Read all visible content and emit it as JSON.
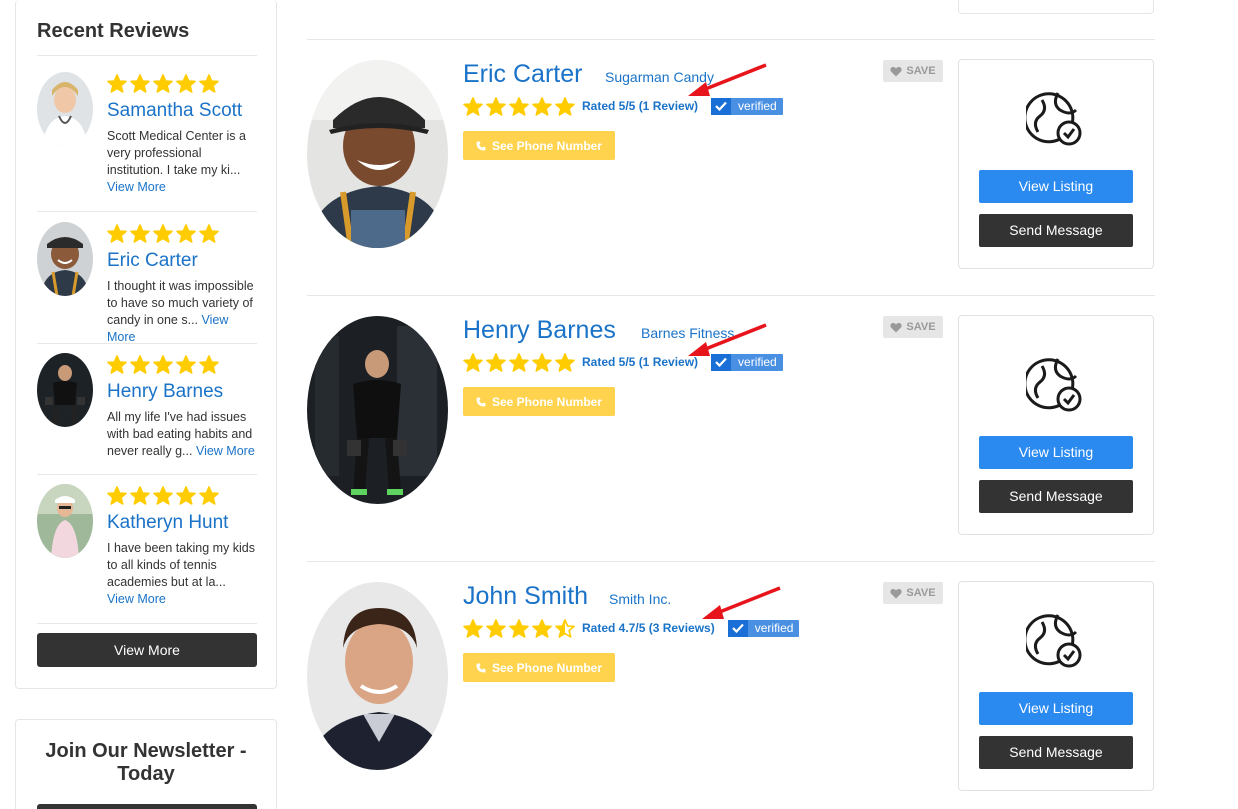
{
  "sidebar": {
    "title": "Recent Reviews",
    "reviews": [
      {
        "name": "Samantha Scott",
        "snippet": "Scott Medical Center is a very professional institution. I take my ki...",
        "more": "View More",
        "rating": 5
      },
      {
        "name": "Eric Carter",
        "snippet": "I thought it was impossible to have so much variety of candy in one s...",
        "more": "View More",
        "rating": 5
      },
      {
        "name": "Henry Barnes",
        "snippet": "All my life I've had issues with bad eating habits and never really g...",
        "more": "View More",
        "rating": 5
      },
      {
        "name": "Katheryn Hunt",
        "snippet": "I have been taking my kids to all kinds of tennis academies but at la...",
        "more": "View More",
        "rating": 5
      }
    ],
    "view_more": "View More",
    "newsletter_title": "Join Our Newsletter - Today"
  },
  "listings": [
    {
      "name": "Eric Carter",
      "company": "Sugarman Candy",
      "rating_text": "Rated 5/5 (1 Review)",
      "rating": 5,
      "verified": "verified",
      "phone": "See Phone Number",
      "save": "SAVE",
      "view": "View Listing",
      "message": "Send Message"
    },
    {
      "name": "Henry Barnes",
      "company": "Barnes Fitness",
      "rating_text": "Rated 5/5 (1 Review)",
      "rating": 5,
      "verified": "verified",
      "phone": "See Phone Number",
      "save": "SAVE",
      "view": "View Listing",
      "message": "Send Message"
    },
    {
      "name": "John Smith",
      "company": "Smith Inc.",
      "rating_text": "Rated 4.7/5 (3 Reviews)",
      "rating": 4.5,
      "verified": "verified",
      "phone": "See Phone Number",
      "save": "SAVE",
      "view": "View Listing",
      "message": "Send Message"
    }
  ],
  "colors": {
    "accent": "#1a73c8",
    "star": "#ffcc00",
    "phone": "#ffd34e",
    "view": "#2a8af0",
    "dark": "#333333",
    "annotation": "#e8141b"
  },
  "icons": {
    "star": "star-icon",
    "globe": "globe-check-icon",
    "heart": "heart-icon",
    "phone": "phone-icon",
    "check": "check-icon",
    "arrow": "annotation-arrow"
  }
}
